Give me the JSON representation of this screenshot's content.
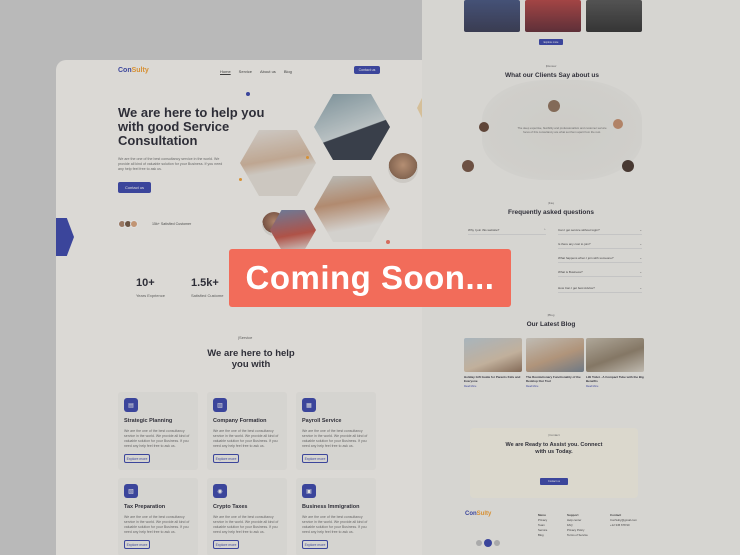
{
  "colors": {
    "brand": "#2d3aa8",
    "accent": "#f59a23",
    "banner": "#f26c5a"
  },
  "nav": {
    "logo_main": "Con",
    "logo_accent": "Sulty",
    "links": [
      "Home",
      "Service",
      "About us",
      "Blog"
    ],
    "contact_button": "Contact us"
  },
  "hero": {
    "title": "We are here to help you with good Service Consultation",
    "description": "We are the one of the best consultancy service in the world. We provide all kind of valuable solution for your Business. If you need any help feel free to ask us.",
    "button": "Contact us",
    "satisfied": "15k+ Satisfied Customer"
  },
  "stats": [
    {
      "value": "10+",
      "label": "Years Exprience"
    },
    {
      "value": "1.5k+",
      "label": "Satisfied Custome"
    }
  ],
  "services": {
    "tag": "|Service",
    "title": "We are here to help you with",
    "items": [
      {
        "icon": "chart-icon",
        "title": "Strategic Planning",
        "description": "We are the one of the best consultancy service in the world. We provide all kind of valuable solution for your Business. If you need any help feel free to ask us.",
        "button": "Explore more"
      },
      {
        "icon": "building-icon",
        "title": "Company Formation",
        "description": "We are the one of the best consultancy service in the world. We provide all kind of valuable solution for your Business. If you need any help feel free to ask us.",
        "button": "Explore more"
      },
      {
        "icon": "document-icon",
        "title": "Payroll Service",
        "description": "We are the one of the best consultancy service in the world. We provide all kind of valuable solution for your Business. If you need any help feel free to ask us.",
        "button": "Explore more"
      },
      {
        "icon": "receipt-icon",
        "title": "Tax Preparation",
        "description": "We are the one of the best consultancy service in the world. We provide all kind of valuable solution for your Business. If you need any help feel free to ask us.",
        "button": "Explore more"
      },
      {
        "icon": "coin-icon",
        "title": "Crypto Taxes",
        "description": "We are the one of the best consultancy service in the world. We provide all kind of valuable solution for your Business. If you need any help feel free to ask us.",
        "button": "Explore more"
      },
      {
        "icon": "migration-icon",
        "title": "Business Immigration",
        "description": "We are the one of the best consultancy service in the world. We provide all kind of valuable solution for your Business. If you need any help feel free to ask us.",
        "button": "Explore more"
      }
    ]
  },
  "right_page": {
    "team_button": "Explore more",
    "review_tag": "|Review",
    "clients_title": "What our Clients Say about us",
    "testimonial": "The deep expertise, flexibility and professionalism and customer service focus of this consultancy are what set them apart from the rest.",
    "faq_tag": "|Faq",
    "faq_title": "Frequently asked questions",
    "faq_left": [
      "Why I join this website?",
      "",
      "",
      ""
    ],
    "faq_right": [
      "Can I get service without login?",
      "Is there any cost to join?",
      "What happens when I join with someone?",
      "What is Business?",
      "How Can I get best Advice?"
    ],
    "blog_tag": "|Blog",
    "blog_title": "Our Latest Blog",
    "blogs": [
      {
        "title": "Holiday Gift Guide for Parents Kids and Everyone",
        "more": "Read More"
      },
      {
        "title": "The Revolutionary Functionality of the Desktop Our Tool",
        "more": "Read More"
      },
      {
        "title": "Lilli Toilet - A Compact Tube with the Big Benefits",
        "more": "Read More"
      }
    ],
    "contact_tag": "|Contact",
    "contact_title": "We are Ready to Assist you. Connect with us Today.",
    "contact_button": "Contact us",
    "footer_logo_main": "Con",
    "footer_logo_accent": "Sulty",
    "footer_cols": [
      {
        "head": "Menu",
        "items": [
          "Privacy",
          "Team",
          "Service",
          "Blog"
        ]
      },
      {
        "head": "Support",
        "items": [
          "Help center",
          "FAQ",
          "Privacy Policy",
          "Terms of Service"
        ]
      },
      {
        "head": "Contact",
        "items": [
          "ConSulty@gmail.com",
          "+12 345 678 90"
        ]
      }
    ]
  },
  "overlay": {
    "banner_text": "Coming Soon..."
  }
}
